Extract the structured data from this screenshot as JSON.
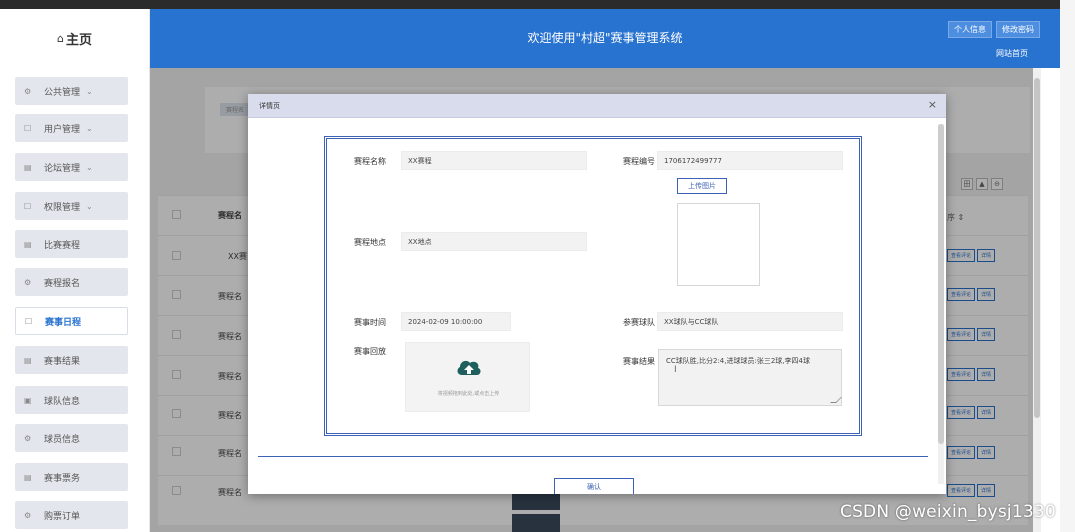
{
  "header": {
    "home_label": "主页",
    "home_icon": "home-icon",
    "title": "欢迎使用\"村超\"赛事管理系统",
    "profile_button": "个人信息",
    "change_password_button": "修改密码",
    "site_home_link": "网站首页",
    "accent_color": "#2872d0"
  },
  "sidebar": {
    "items": [
      {
        "label": "公共管理",
        "icon": "gear-icon",
        "has_submenu": true
      },
      {
        "label": "用户管理",
        "icon": "user-icon",
        "has_submenu": true
      },
      {
        "label": "论坛管理",
        "icon": "list-icon",
        "has_submenu": true
      },
      {
        "label": "权限管理",
        "icon": "lock-icon",
        "has_submenu": true
      },
      {
        "label": "比赛赛程",
        "icon": "list-icon",
        "has_submenu": false
      },
      {
        "label": "赛程报名",
        "icon": "gear-icon",
        "has_submenu": false
      },
      {
        "label": "赛事日程",
        "icon": "doc-icon",
        "has_submenu": false,
        "active": true
      },
      {
        "label": "赛事结果",
        "icon": "list-icon",
        "has_submenu": false
      },
      {
        "label": "球队信息",
        "icon": "image-icon",
        "has_submenu": false
      },
      {
        "label": "球员信息",
        "icon": "gear-icon",
        "has_submenu": false
      },
      {
        "label": "赛事票务",
        "icon": "list-icon",
        "has_submenu": false
      },
      {
        "label": "购票订单",
        "icon": "gear-icon",
        "has_submenu": false
      }
    ]
  },
  "background": {
    "tag_label": "赛程名",
    "column_header": "赛程名",
    "rows": [
      "XX赛",
      "赛程名",
      "赛程名",
      "赛程名",
      "赛程名",
      "赛程名",
      "赛程名"
    ],
    "action_comment": "查看评论",
    "action_detail": "详情",
    "sort_label": "序 ⇕",
    "tools": [
      "田",
      "▲",
      "⊖"
    ]
  },
  "modal": {
    "title": "详情页",
    "close_symbol": "×",
    "fields": {
      "schedule_name_label": "赛程名称",
      "schedule_name_value": "XX赛程",
      "schedule_no_label": "赛程编号",
      "schedule_no_value": "1706172499777",
      "upload_image_button": "上传图片",
      "location_label": "赛程地点",
      "location_value": "XX地点",
      "match_time_label": "赛事时间",
      "match_time_value": "2024-02-09 10:00:00",
      "teams_label": "参赛球队",
      "teams_value": "XX球队与CC球队",
      "replay_label": "赛事回放",
      "replay_hint": "将视频拖到此处,或点击上传",
      "result_label": "赛事结果",
      "result_value": "CC球队胜,比分2:4,进球球员:张三2球,李四4球"
    },
    "confirm_button": "确认"
  },
  "watermark": "CSDN @weixin_bysj1330"
}
